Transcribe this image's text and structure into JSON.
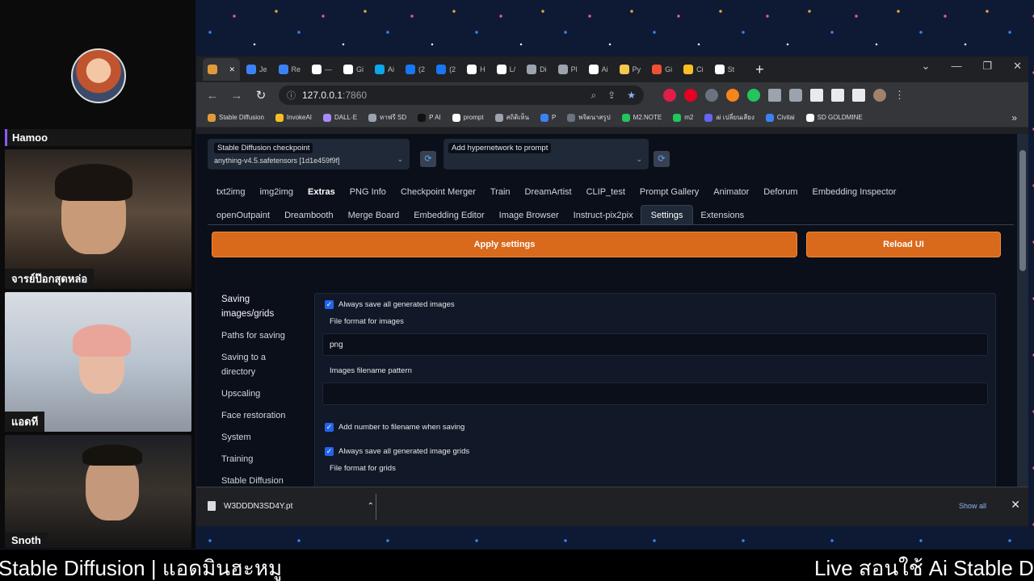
{
  "stream": {
    "participants": [
      {
        "name": "Hamoo"
      },
      {
        "name": "จารย์ป๊อกสุดหล่อ"
      },
      {
        "name": "แอดที"
      },
      {
        "name": "Snoth"
      }
    ],
    "ticker_left": "Stable Diffusion | แอดมินฮะหมู",
    "ticker_right": "Live สอนใช้ Ai Stable D"
  },
  "browser": {
    "tabs": [
      {
        "label": "",
        "icon": "stable-diffusion-icon",
        "color": "#e09a3b",
        "active": true
      },
      {
        "label": "Je",
        "icon": "c-icon",
        "color": "#3b82f6"
      },
      {
        "label": "Re",
        "icon": "c-icon",
        "color": "#3b82f6"
      },
      {
        "label": "—",
        "icon": "r-icon",
        "color": "#ffffff"
      },
      {
        "label": "Gi",
        "icon": "github-icon",
        "color": "#ffffff"
      },
      {
        "label": "Ai",
        "icon": "a-icon",
        "color": "#0ea5e9"
      },
      {
        "label": "(2",
        "icon": "facebook-icon",
        "color": "#1877f2"
      },
      {
        "label": "(2",
        "icon": "facebook-icon",
        "color": "#1877f2"
      },
      {
        "label": "H",
        "icon": "h-icon",
        "color": "#ffffff"
      },
      {
        "label": "L/",
        "icon": "paw-icon",
        "color": "#ffffff"
      },
      {
        "label": "Di",
        "icon": "doc-icon",
        "color": "#9ca3af"
      },
      {
        "label": "Pl",
        "icon": "pl-icon",
        "color": "#9ca3af"
      },
      {
        "label": "Ai",
        "icon": "p-icon",
        "color": "#ffffff"
      },
      {
        "label": "Py",
        "icon": "python-icon",
        "color": "#f2c94c"
      },
      {
        "label": "Gi",
        "icon": "git-icon",
        "color": "#f05133"
      },
      {
        "label": "Ci",
        "icon": "hug-icon",
        "color": "#fbbf24"
      },
      {
        "label": "St",
        "icon": "r-icon",
        "color": "#ffffff"
      }
    ],
    "url": "127.0.0.1",
    "url_port": ":7860",
    "bookmarks": [
      {
        "label": "Stable Diffusion",
        "color": "#e09a3b"
      },
      {
        "label": "InvokeAI",
        "color": "#fbbf24"
      },
      {
        "label": "DALL·E",
        "color": "#a78bfa"
      },
      {
        "label": "หาฟรี SD",
        "color": "#9ca3af"
      },
      {
        "label": "P AI",
        "color": "#111111"
      },
      {
        "label": "prompt",
        "color": "#ffffff"
      },
      {
        "label": "สถิติเห็น",
        "color": "#9ca3af"
      },
      {
        "label": "P",
        "color": "#3b82f6"
      },
      {
        "label": "พจิตนาสรูป",
        "color": "#6b7280"
      },
      {
        "label": "M2.NOTE",
        "color": "#22c55e"
      },
      {
        "label": "m2",
        "color": "#22c55e"
      },
      {
        "label": "ai เปลี่ยนเสียง",
        "color": "#6366f1"
      },
      {
        "label": "Civitai",
        "color": "#3b82f6"
      },
      {
        "label": "SD GOLDMINE",
        "color": "#ffffff"
      }
    ],
    "download": {
      "file": "W3DDDN3SD4Y.pt",
      "show_all": "Show all"
    }
  },
  "webui": {
    "checkpoint_label": "Stable Diffusion checkpoint",
    "checkpoint_value": "anything-v4.5.safetensors [1d1e459f9f]",
    "hypernetwork_label": "Add hypernetwork to prompt",
    "tabs_row1": [
      "txt2img",
      "img2img",
      "Extras",
      "PNG Info",
      "Checkpoint Merger",
      "Train",
      "DreamArtist",
      "CLIP_test",
      "Prompt Gallery",
      "Animator",
      "Deforum",
      "Embedding Inspector"
    ],
    "tabs_row2": [
      "openOutpaint",
      "Dreambooth",
      "Merge Board",
      "Embedding Editor",
      "Image Browser",
      "Instruct-pix2pix",
      "Settings",
      "Extensions"
    ],
    "apply_label": "Apply settings",
    "reload_label": "Reload UI",
    "sidebar": [
      "Saving images/grids",
      "Paths for saving",
      "Saving to a directory",
      "Upscaling",
      "Face restoration",
      "System",
      "Training",
      "Stable Diffusion"
    ],
    "settings": {
      "always_save_images": "Always save all generated images",
      "file_format_images_label": "File format for images",
      "file_format_images_value": "png",
      "filename_pattern_label": "Images filename pattern",
      "filename_pattern_value": "",
      "add_number": "Add number to filename when saving",
      "always_save_grids": "Always save all generated image grids",
      "file_format_grids_label": "File format for grids"
    }
  }
}
